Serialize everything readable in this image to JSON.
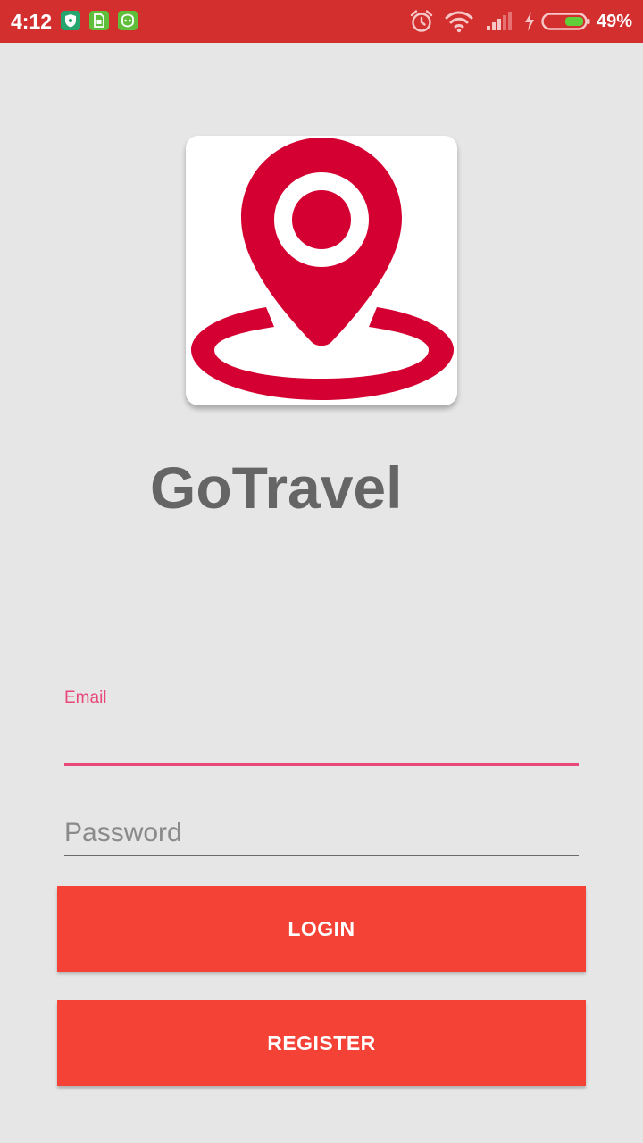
{
  "status_bar": {
    "time": "4:12",
    "battery_percent": "49%",
    "notification_icons": [
      "shield-notification-icon",
      "sim-card-notification-icon",
      "android-notification-icon"
    ],
    "system_icons": [
      "alarm-icon",
      "wifi-icon",
      "cellular-signal-icon",
      "charging-bolt-icon",
      "battery-icon"
    ],
    "background_color": "#d32f2f"
  },
  "app": {
    "name": "GoTravel",
    "logo": "location-pin-icon",
    "logo_color": "#d50032"
  },
  "form": {
    "email_label": "Email",
    "email_value": "",
    "password_placeholder": "Password",
    "password_value": "",
    "accent_color": "#e8477a"
  },
  "buttons": {
    "login_label": "LOGIN",
    "register_label": "REGISTER",
    "color": "#f44336"
  }
}
